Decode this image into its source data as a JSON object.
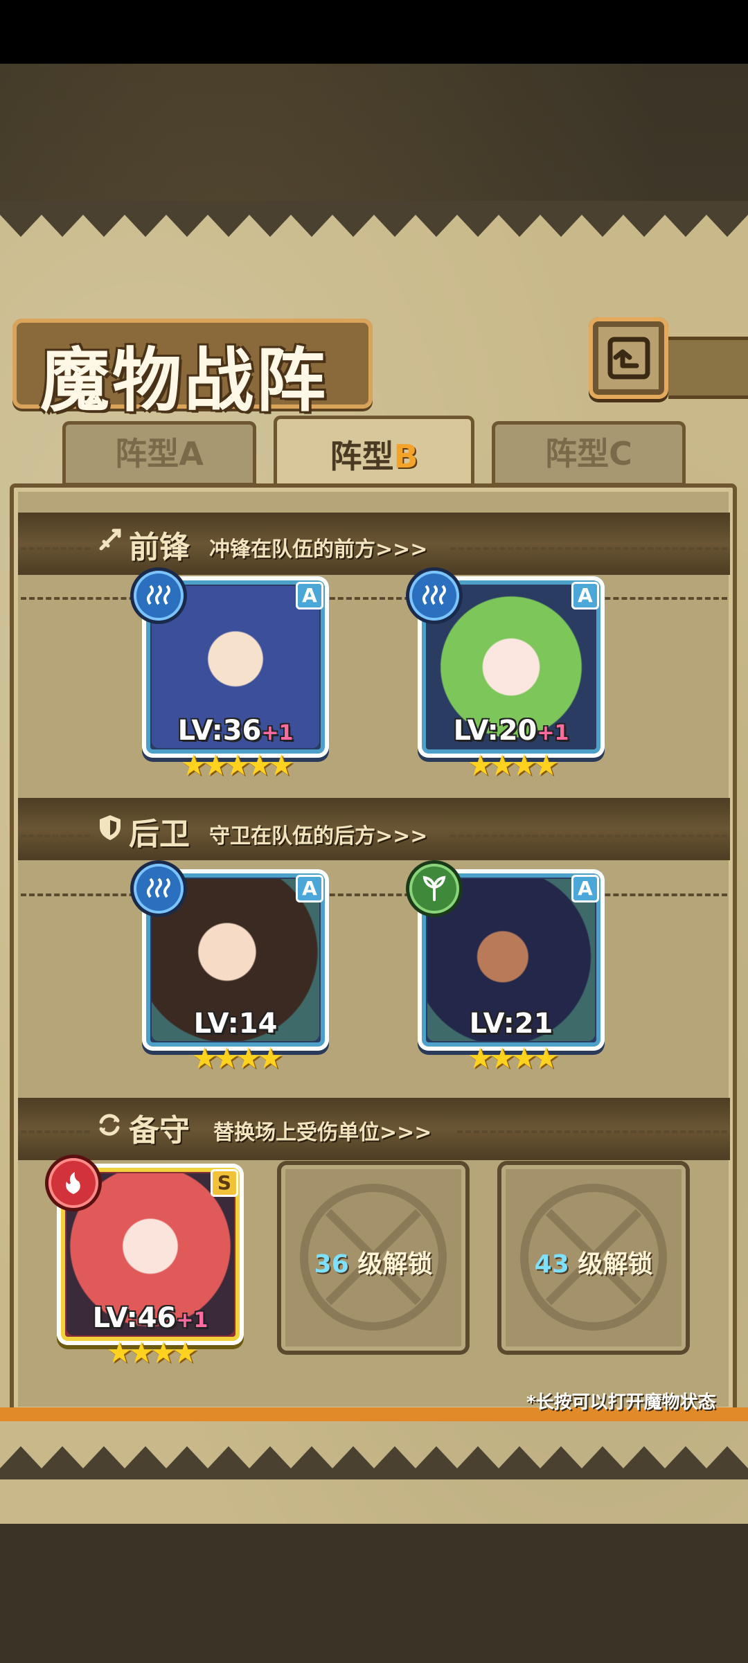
{
  "screen": {
    "title": "魔物战阵",
    "back_icon": "back-arrow-icon"
  },
  "tabs": [
    {
      "label": "阵型A",
      "active": false
    },
    {
      "label_prefix": "阵型",
      "label_letter": "B",
      "active": true
    },
    {
      "label": "阵型C",
      "active": false
    }
  ],
  "sections": {
    "front": {
      "icon": "sword-icon",
      "title": "前锋",
      "subtitle": "冲锋在队伍的前方>>>"
    },
    "rear": {
      "icon": "shield-icon",
      "title": "后卫",
      "subtitle": "守卫在队伍的后方>>>"
    },
    "reserve": {
      "icon": "swap-icon",
      "title": "备守",
      "subtitle": "替换场上受伤单位>>>"
    }
  },
  "monsters": {
    "front_1": {
      "element": "water",
      "rank": "A",
      "level": "LV:36",
      "bonus": "+1",
      "stars": "★★★★★",
      "palette": "#4a5fa8"
    },
    "front_2": {
      "element": "water",
      "rank": "A",
      "level": "LV:20",
      "bonus": "+1",
      "stars": "★★★★",
      "palette": "#8fcf6a"
    },
    "rear_1": {
      "element": "water",
      "rank": "A",
      "level": "LV:14",
      "bonus": "",
      "stars": "★★★★",
      "palette": "#3a2a2a"
    },
    "rear_2": {
      "element": "leaf",
      "rank": "A",
      "level": "LV:21",
      "bonus": "",
      "stars": "★★★★",
      "palette": "#2b2f55"
    },
    "reserve_1": {
      "element": "fire",
      "rank": "S",
      "level": "LV:46",
      "bonus": "+1",
      "stars": "★★★★",
      "palette": "#e05a5a"
    }
  },
  "locked_slots": [
    {
      "level": "36",
      "text": "级解锁"
    },
    {
      "level": "43",
      "text": "级解锁"
    }
  ],
  "hint": "*长按可以打开魔物状态"
}
